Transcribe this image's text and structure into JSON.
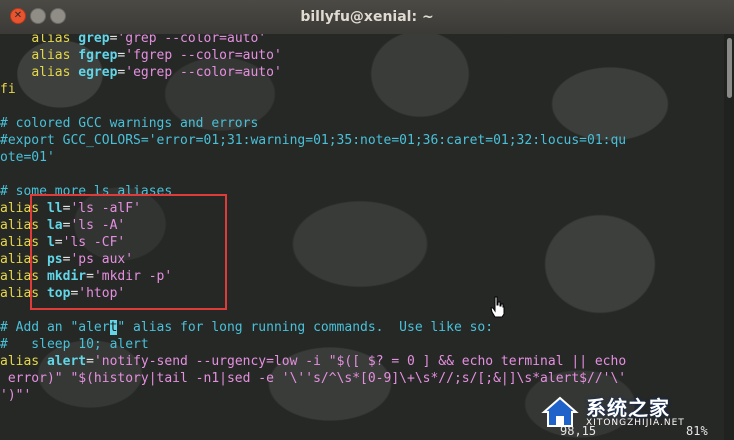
{
  "window": {
    "title": "billyfu@xenial: ~"
  },
  "terminal": {
    "lines": [
      [
        {
          "t": "    ",
          "c": "plain"
        },
        {
          "t": "alias",
          "c": "kw"
        },
        {
          "t": " ",
          "c": "plain"
        },
        {
          "t": "grep",
          "c": "name"
        },
        {
          "t": "=",
          "c": "plain"
        },
        {
          "t": "'grep --color=auto'",
          "c": "str"
        }
      ],
      [
        {
          "t": "    ",
          "c": "plain"
        },
        {
          "t": "alias",
          "c": "kw"
        },
        {
          "t": " ",
          "c": "plain"
        },
        {
          "t": "fgrep",
          "c": "name"
        },
        {
          "t": "=",
          "c": "plain"
        },
        {
          "t": "'fgrep --color=auto'",
          "c": "str"
        }
      ],
      [
        {
          "t": "    ",
          "c": "plain"
        },
        {
          "t": "alias",
          "c": "kw"
        },
        {
          "t": " ",
          "c": "plain"
        },
        {
          "t": "egrep",
          "c": "name"
        },
        {
          "t": "=",
          "c": "plain"
        },
        {
          "t": "'egrep --color=auto'",
          "c": "str"
        }
      ],
      [
        {
          "t": "fi",
          "c": "kw"
        }
      ],
      [],
      [
        {
          "t": "# colored GCC warnings and errors",
          "c": "cmt"
        }
      ],
      [
        {
          "t": "#export GCC_COLORS='error=01;31:warning=01;35:note=01;36:caret=01;32:locus=01:qu",
          "c": "cmt"
        }
      ],
      [
        {
          "t": "ote=01'",
          "c": "cmt"
        }
      ],
      [],
      [
        {
          "t": "# some more ls aliases",
          "c": "cmt"
        }
      ],
      [
        {
          "t": "alias",
          "c": "kw"
        },
        {
          "t": " ",
          "c": "plain"
        },
        {
          "t": "ll",
          "c": "name"
        },
        {
          "t": "=",
          "c": "plain"
        },
        {
          "t": "'ls -alF'",
          "c": "str"
        }
      ],
      [
        {
          "t": "alias",
          "c": "kw"
        },
        {
          "t": " ",
          "c": "plain"
        },
        {
          "t": "la",
          "c": "name"
        },
        {
          "t": "=",
          "c": "plain"
        },
        {
          "t": "'ls -A'",
          "c": "str"
        }
      ],
      [
        {
          "t": "alias",
          "c": "kw"
        },
        {
          "t": " ",
          "c": "plain"
        },
        {
          "t": "l",
          "c": "name"
        },
        {
          "t": "=",
          "c": "plain"
        },
        {
          "t": "'ls -CF'",
          "c": "str"
        }
      ],
      [
        {
          "t": "alias",
          "c": "kw"
        },
        {
          "t": " ",
          "c": "plain"
        },
        {
          "t": "ps",
          "c": "name"
        },
        {
          "t": "=",
          "c": "plain"
        },
        {
          "t": "'ps aux'",
          "c": "str"
        }
      ],
      [
        {
          "t": "alias",
          "c": "kw"
        },
        {
          "t": " ",
          "c": "plain"
        },
        {
          "t": "mkdir",
          "c": "name"
        },
        {
          "t": "=",
          "c": "plain"
        },
        {
          "t": "'mkdir -p'",
          "c": "str"
        }
      ],
      [
        {
          "t": "alias",
          "c": "kw"
        },
        {
          "t": " ",
          "c": "plain"
        },
        {
          "t": "top",
          "c": "name"
        },
        {
          "t": "=",
          "c": "plain"
        },
        {
          "t": "'htop'",
          "c": "str"
        }
      ],
      [],
      [
        {
          "t": "# Add an \"aler",
          "c": "cmt"
        },
        {
          "t": "t",
          "c": "cursor"
        },
        {
          "t": "\" alias for long running commands.  Use like so:",
          "c": "cmt"
        }
      ],
      [
        {
          "t": "#   sleep 10; alert",
          "c": "cmt"
        }
      ],
      [
        {
          "t": "alias",
          "c": "kw"
        },
        {
          "t": " ",
          "c": "plain"
        },
        {
          "t": "alert",
          "c": "name"
        },
        {
          "t": "=",
          "c": "plain"
        },
        {
          "t": "'notify-send --urgency=low -i \"$([ $? = 0 ] && echo terminal || echo",
          "c": "str"
        }
      ],
      [
        {
          "t": " error)\" \"$(history|tail -n1|sed -e '\\''s/^\\s*[0-9]\\+\\s*//;s/[;&|]\\s*alert$//'\\'",
          "c": "str"
        }
      ],
      [
        {
          "t": "')\"'",
          "c": "str"
        }
      ]
    ],
    "status_position": "98,15",
    "status_percent": "81%"
  },
  "watermark": {
    "text": "系统之家",
    "url": "XITONGZHIJIA.NET"
  }
}
